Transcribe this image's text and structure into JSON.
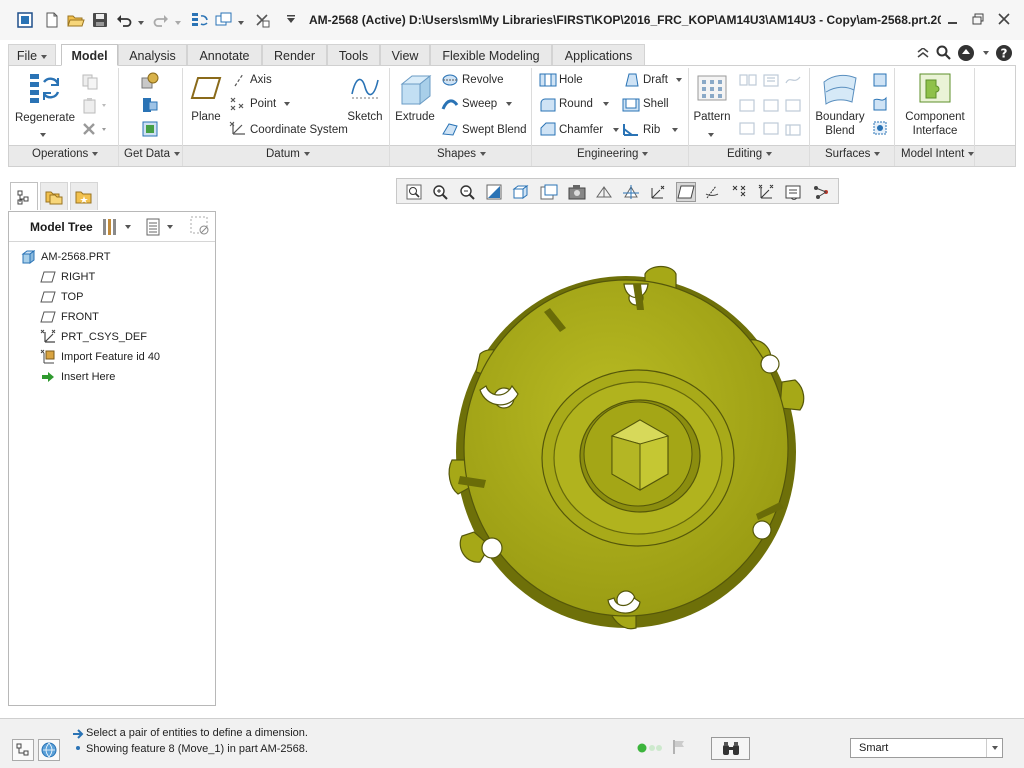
{
  "window": {
    "title": "AM-2568 (Active) D:\\Users\\sm\\My Libraries\\FIRST\\KOP\\2016_FRC_KOP\\AM14U3\\AM14U3 - Copy\\am-2568.prt.20..."
  },
  "quick_access": [
    "app-icon",
    "new-icon",
    "open-icon",
    "save-icon",
    "undo-icon",
    "redo-icon",
    "regenerate-icon",
    "windows-icon",
    "close-window-icon"
  ],
  "tabs": [
    {
      "label": "File",
      "has_dropdown": true
    },
    {
      "label": "Model",
      "active": true
    },
    {
      "label": "Analysis"
    },
    {
      "label": "Annotate"
    },
    {
      "label": "Render"
    },
    {
      "label": "Tools"
    },
    {
      "label": "View"
    },
    {
      "label": "Flexible Modeling"
    },
    {
      "label": "Applications"
    }
  ],
  "ribbon": {
    "operations": {
      "regenerate": "Regenerate",
      "group": "Operations"
    },
    "get_data": {
      "group": "Get Data"
    },
    "datum": {
      "plane": "Plane",
      "axis": "Axis",
      "point": "Point",
      "coordinate_system": "Coordinate System",
      "sketch": "Sketch",
      "group": "Datum"
    },
    "shapes": {
      "extrude": "Extrude",
      "revolve": "Revolve",
      "sweep": "Sweep",
      "swept_blend": "Swept Blend",
      "group": "Shapes"
    },
    "engineering": {
      "hole": "Hole",
      "round": "Round",
      "chamfer": "Chamfer",
      "draft": "Draft",
      "shell": "Shell",
      "rib": "Rib",
      "group": "Engineering"
    },
    "editing": {
      "pattern": "Pattern",
      "group": "Editing"
    },
    "surfaces": {
      "boundary_blend_1": "Boundary",
      "boundary_blend_2": "Blend",
      "group": "Surfaces"
    },
    "model_intent": {
      "component_interface_1": "Component",
      "component_interface_2": "Interface",
      "group": "Model Intent"
    }
  },
  "model_tree": {
    "header": "Model Tree",
    "root": "AM-2568.PRT",
    "items": [
      {
        "label": "RIGHT",
        "icon": "datum-plane-icon"
      },
      {
        "label": "TOP",
        "icon": "datum-plane-icon"
      },
      {
        "label": "FRONT",
        "icon": "datum-plane-icon"
      },
      {
        "label": "PRT_CSYS_DEF",
        "icon": "csys-icon"
      },
      {
        "label": "Import Feature id 40",
        "icon": "import-feature-icon"
      },
      {
        "label": "Insert Here",
        "icon": "insert-arrow-icon"
      }
    ]
  },
  "graphics_toolbar": [
    "refit-icon",
    "zoom-in-icon",
    "zoom-out-icon",
    "repaint-icon",
    "saved-orientations-icon",
    "view-manager-icon",
    "display-style-icon",
    "perspective-icon",
    "spin-center-icon",
    "datum-display-icon",
    "annotation-display-icon",
    "plane-display-icon",
    "axis-display-icon",
    "point-display-icon",
    "csys-display-icon",
    "sketch-display-icon"
  ],
  "status": {
    "line1": "Select a pair of entities to define a dimension.",
    "line2": "Showing feature 8 (Move_1) in part AM-2568.",
    "filter": "Smart"
  },
  "colors": {
    "part_fill": "#a6a817",
    "part_dark": "#5c5e08",
    "part_light": "#c9cb3a",
    "background": "#ffffff",
    "accent": "#2a73b5"
  }
}
